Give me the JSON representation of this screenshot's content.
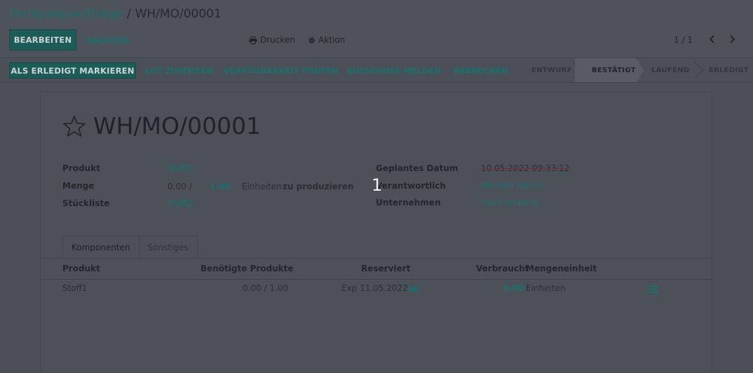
{
  "breadcrumb": {
    "parent": "Fertigungsaufträge",
    "separator": "/",
    "current": "WH/MO/00001"
  },
  "toolbar": {
    "edit_label": "BEARBEITEN",
    "create_label": "ANLEGEN",
    "print_label": "Drucken",
    "action_label": "Aktion",
    "pager": "1 / 1"
  },
  "actions": {
    "mark_done": "ALS ERLEDIGT MARKIEREN",
    "assign_lot": "LOT ZUWEISEN",
    "check_availability": "VERFÜGBARKEIT PRÜFEN",
    "scrap": "AUSSCHUSS MELDEN",
    "cancel": "ABBRECHEN"
  },
  "statusbar": {
    "steps": [
      "ENTWURF",
      "BESTÄTIGT",
      "LAUFEND",
      "ERLEDIGT"
    ],
    "active": "BESTÄTIGT"
  },
  "record": {
    "title": "WH/MO/00001",
    "fields_left": {
      "product_label": "Produkt",
      "product_value": "Stoff2",
      "qty_label": "Menge",
      "qty_done": "0.00",
      "qty_sep": "/",
      "qty_total": "1.00",
      "qty_uom": "Einheiten",
      "qty_suffix": "zu produzieren",
      "bom_label": "Stückliste",
      "bom_value": "Stoff2"
    },
    "fields_right": {
      "date_label": "Geplantes Datum",
      "date_value": "10.05.2022 09:33:12",
      "user_label": "Verantwortlich",
      "user_value": "Mitchell Admin",
      "company_label": "Unternehmen",
      "company_value": "YourCompany"
    },
    "overlay_number": "1"
  },
  "tabs": [
    "Komponenten",
    "Sonstiges"
  ],
  "table": {
    "headers": [
      "Produkt",
      "Benötigte Produkte",
      "Reserviert",
      "Verbraucht",
      "Mengeneinheit"
    ],
    "rows": [
      {
        "product": "Stoff1",
        "needed": "0.00 / 1.00",
        "reserved": "Exp 11.05.2022",
        "consumed": "0.00",
        "uom": "Einheiten"
      }
    ]
  },
  "colors": {
    "accent": "#1c6f6b",
    "primary_button": "#1d5b58",
    "overlay": "#4a4f58"
  }
}
